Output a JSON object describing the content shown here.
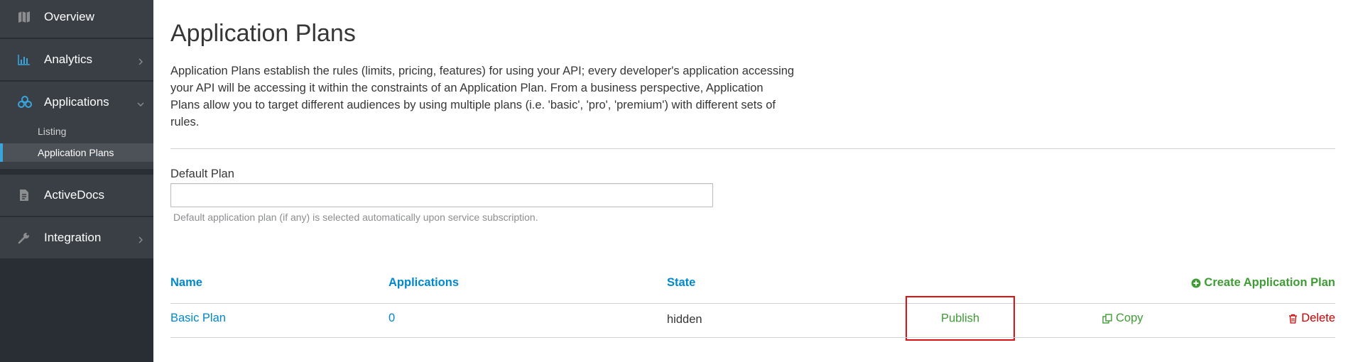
{
  "sidebar": {
    "items": [
      {
        "label": "Overview",
        "icon": "map-icon"
      },
      {
        "label": "Analytics",
        "icon": "bar-chart-icon"
      },
      {
        "label": "Applications",
        "icon": "cubes-icon"
      },
      {
        "label": "ActiveDocs",
        "icon": "document-icon"
      },
      {
        "label": "Integration",
        "icon": "wrench-icon"
      }
    ],
    "subitems": [
      {
        "label": "Listing"
      },
      {
        "label": "Application Plans"
      }
    ]
  },
  "page": {
    "title": "Application Plans",
    "intro": "Application Plans establish the rules (limits, pricing, features) for using your API; every developer's application accessing your API will be accessing it within the constraints of an Application Plan. From a business perspective, Application Plans allow you to target different audiences by using multiple plans (i.e. 'basic', 'pro', 'premium') with different sets of rules."
  },
  "default_plan": {
    "label": "Default Plan",
    "value": "",
    "help": "Default application plan (if any) is selected automatically upon service subscription."
  },
  "table": {
    "headers": {
      "name": "Name",
      "applications": "Applications",
      "state": "State"
    },
    "create_label": "Create Application Plan",
    "rows": [
      {
        "name": "Basic Plan",
        "applications": "0",
        "state": "hidden",
        "publish": "Publish",
        "copy": "Copy",
        "delete": "Delete"
      }
    ]
  },
  "colors": {
    "link": "#0088ce",
    "success": "#3f9c35",
    "danger": "#cc0000",
    "sidebar_bg": "#292e34",
    "sidebar_item_bg": "#393f44",
    "highlight_accent": "#39a5dc"
  }
}
